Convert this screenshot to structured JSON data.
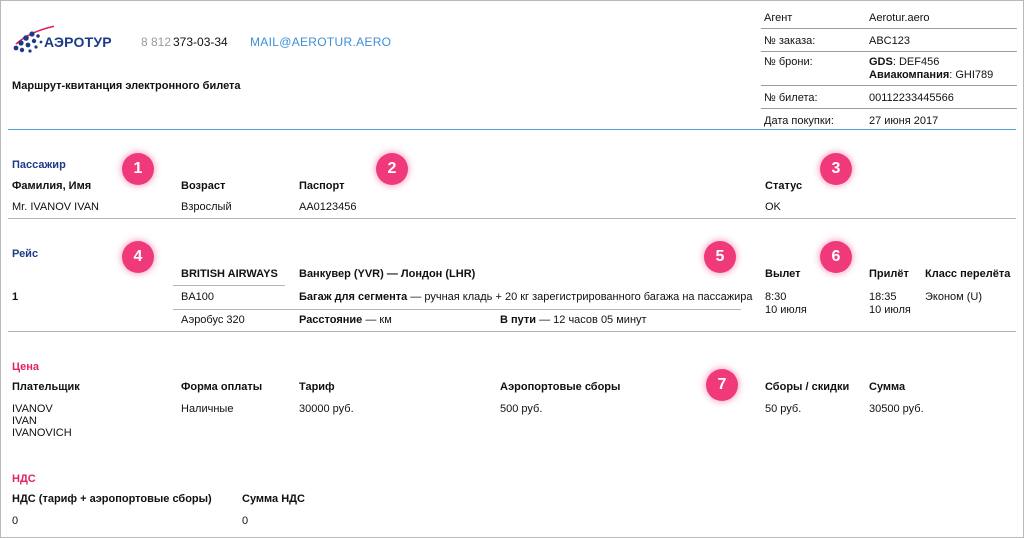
{
  "header": {
    "logo_text": "АЭРОТУР",
    "phone_prefix": "8 812",
    "phone_number": "373-03-34",
    "email": "MAIL@AEROTUR.AERO",
    "doc_title": "Маршрут-квитанция  электронного билета"
  },
  "info": {
    "agent_label": "Агент",
    "agent_value": "Aerotur.aero",
    "order_label": "№ заказа:",
    "order_value": "ABC123",
    "booking_label": "№ брони:",
    "gds_label": "GDS",
    "gds_value": ": DEF456",
    "airline_label": "Авиакомпания",
    "airline_value": ": GHI789",
    "ticket_label": "№ билета:",
    "ticket_value": "00112233445566",
    "date_label": "Дата  покупки:",
    "date_value": "27 июня 2017"
  },
  "passenger": {
    "section": "Пассажир",
    "name_header": "Фамилия, Имя",
    "age_header": "Возраст",
    "passport_header": "Паспорт",
    "status_header": "Статус",
    "name": "Mr. IVANOV IVAN",
    "age": "Взрослый",
    "passport": "AA0123456",
    "status": "OK"
  },
  "flight": {
    "section": "Рейс",
    "index": "1",
    "airline": "BRITISH AIRWAYS",
    "flight_no": "BA100",
    "aircraft": "Аэробус 320",
    "route": "Ванкувер (YVR) — Лондон (LHR)",
    "baggage_label": "Багаж для сегмента",
    "baggage_value": " — ручная кладь + 20 кг зарегистрированного багажа на пассажира",
    "distance_label": "Расстояние",
    "distance_value": " — км",
    "duration_label": "В пути",
    "duration_value": " — 12 часов 05 минут",
    "departure_header": "Вылет",
    "departure_time": "8:30",
    "departure_date": "10 июля",
    "arrival_header": "Прилёт",
    "arrival_time": "18:35",
    "arrival_date": "10 июля",
    "class_header": "Класс перелёта",
    "class_value": "Эконом (U)"
  },
  "price": {
    "section": "Цена",
    "payer_header": "Плательщик",
    "payer_lines": [
      "IVANOV",
      "IVAN",
      "IVANOVICH"
    ],
    "payment_header": "Форма оплаты",
    "payment_value": "Наличные",
    "tariff_header": "Тариф",
    "tariff_value": "30000 руб.",
    "airport_fees_header": "Аэропортовые сборы",
    "airport_fees_value": "500 руб.",
    "fees_discounts_header": "Сборы / скидки",
    "fees_discounts_value": "50 руб.",
    "total_header": "Сумма",
    "total_value": "30500 руб."
  },
  "vat": {
    "section": "НДС",
    "vat_header": "НДС (тариф + аэропортовые сборы)",
    "vat_value": "0",
    "vat_sum_header": "Сумма НДС",
    "vat_sum_value": "0"
  },
  "badges": [
    "1",
    "2",
    "3",
    "4",
    "5",
    "6",
    "7"
  ],
  "colors": {
    "badge": "#f0397a",
    "section_blue": "#1c3b87",
    "section_pink": "#e0245e",
    "email": "#3c8fd6",
    "divider_blue": "#4aa3d6"
  }
}
